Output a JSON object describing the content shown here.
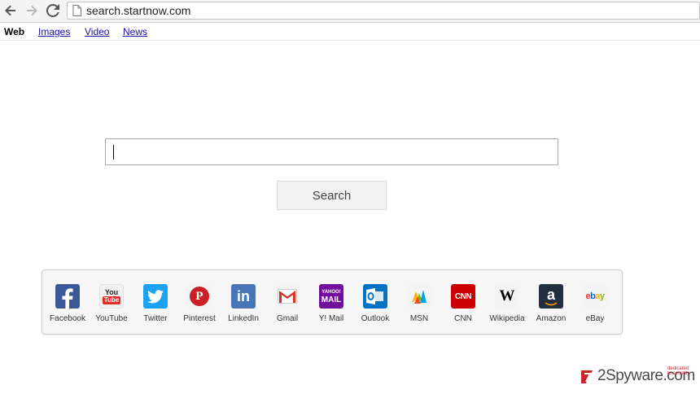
{
  "browser": {
    "url": "search.startnow.com",
    "icons": {
      "back": "back-arrow-icon",
      "forward": "forward-arrow-icon",
      "reload": "reload-icon",
      "page": "page-icon"
    }
  },
  "tabs": [
    {
      "label": "Web",
      "active": true
    },
    {
      "label": "Images",
      "active": false
    },
    {
      "label": "Video",
      "active": false
    },
    {
      "label": "News",
      "active": false
    }
  ],
  "search": {
    "input_value": "",
    "button_label": "Search"
  },
  "shortcuts": [
    {
      "label": "Facebook",
      "icon": "facebook-icon",
      "color": "#3b5998"
    },
    {
      "label": "YouTube",
      "icon": "youtube-icon",
      "color": "#e52d27"
    },
    {
      "label": "Twitter",
      "icon": "twitter-icon",
      "color": "#1da1f2"
    },
    {
      "label": "Pinterest",
      "icon": "pinterest-icon",
      "color": "#cb2027"
    },
    {
      "label": "LinkedIn",
      "icon": "linkedin-icon",
      "color": "#4875b4"
    },
    {
      "label": "Gmail",
      "icon": "gmail-icon",
      "color": "#d93025"
    },
    {
      "label": "Y! Mail",
      "icon": "yahoo-mail-icon",
      "color": "#720e9e"
    },
    {
      "label": "Outlook",
      "icon": "outlook-icon",
      "color": "#0072c6"
    },
    {
      "label": "MSN",
      "icon": "msn-icon",
      "color": "#00a4ef"
    },
    {
      "label": "CNN",
      "icon": "cnn-icon",
      "color": "#cc0000"
    },
    {
      "label": "Wikipedia",
      "icon": "wikipedia-icon",
      "color": "#000000"
    },
    {
      "label": "Amazon",
      "icon": "amazon-icon",
      "color": "#232f3e"
    },
    {
      "label": "eBay",
      "icon": "ebay-icon",
      "color": "#e53238"
    }
  ],
  "icon_text": {
    "youtube_top": "You",
    "youtube_bottom": "Tube",
    "linkedin": "in",
    "yahoo_top": "YAHOO!",
    "yahoo_bottom": "MAIL",
    "cnn": "CNN",
    "wikipedia": "W",
    "amazon": "a",
    "ebay_e": "e",
    "ebay_b": "b",
    "ebay_a": "a",
    "ebay_y": "y",
    "pinterest": "P"
  },
  "watermark": {
    "brand": "2Spyware",
    "tld": ".com",
    "tagline_1": "dedicated",
    "tagline_2": "to security"
  }
}
